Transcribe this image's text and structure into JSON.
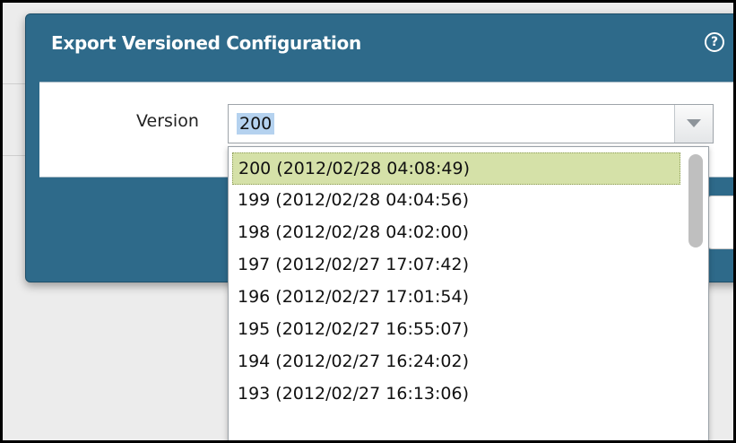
{
  "dialog": {
    "title": "Export Versioned Configuration",
    "help_icon": "question-circle-icon",
    "help_glyph": "?"
  },
  "version_field": {
    "label": "Version",
    "value": "200",
    "dropdown_icon": "chevron-down-icon"
  },
  "dropdown": {
    "options": [
      "200 (2012/02/28 04:08:49)",
      "199 (2012/02/28 04:04:56)",
      "198 (2012/02/28 04:02:00)",
      "197 (2012/02/27 17:07:42)",
      "196 (2012/02/27 17:01:54)",
      "195 (2012/02/27 16:55:07)",
      "194 (2012/02/27 16:24:02)",
      "193 (2012/02/27 16:13:06)"
    ],
    "selected": "200 (2012/02/28 04:08:49)"
  },
  "colors": {
    "dialog_header": "#2e6a8a",
    "selected_option": "#d5e1a8",
    "text_selection": "#b5d2ef"
  }
}
